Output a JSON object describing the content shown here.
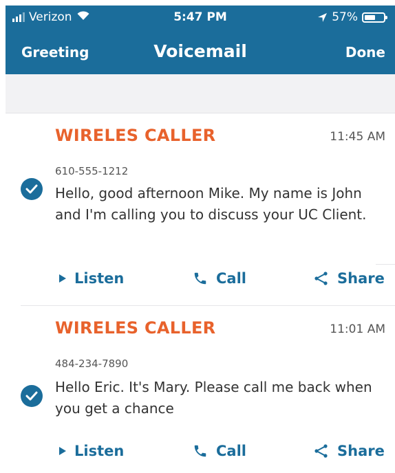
{
  "status_bar": {
    "carrier": "Verizon",
    "time": "5:47 PM",
    "battery": "57%",
    "battery_level": 0.57,
    "icons": [
      "signal-bars-icon",
      "wifi-icon",
      "location-arrow-icon",
      "battery-icon"
    ]
  },
  "nav": {
    "left": "Greeting",
    "title": "Voicemail",
    "right": "Done"
  },
  "colors": {
    "brand": "#1b6d9b",
    "caller": "#e8622c",
    "background": "#ffffff",
    "separator": "#f2f2f4"
  },
  "voicemails": [
    {
      "caller": "WIRELES CALLER",
      "time": "11:45 AM",
      "number": "610-555-1212",
      "message": "Hello, good afternoon Mike. My name is John and I'm calling you to discuss your UC Client.",
      "checked": true,
      "actions": {
        "listen": "Listen",
        "call": "Call",
        "share": "Share"
      }
    },
    {
      "caller": "WIRELES CALLER",
      "time": "11:01 AM",
      "number": "484-234-7890",
      "message": "Hello Eric. It's Mary. Please call me back when you get a chance",
      "checked": true,
      "actions": {
        "listen": "Listen",
        "call": "Call",
        "share": "Share"
      }
    }
  ],
  "action_icons": {
    "listen": "play-icon",
    "call": "phone-icon",
    "share": "share-icon"
  }
}
